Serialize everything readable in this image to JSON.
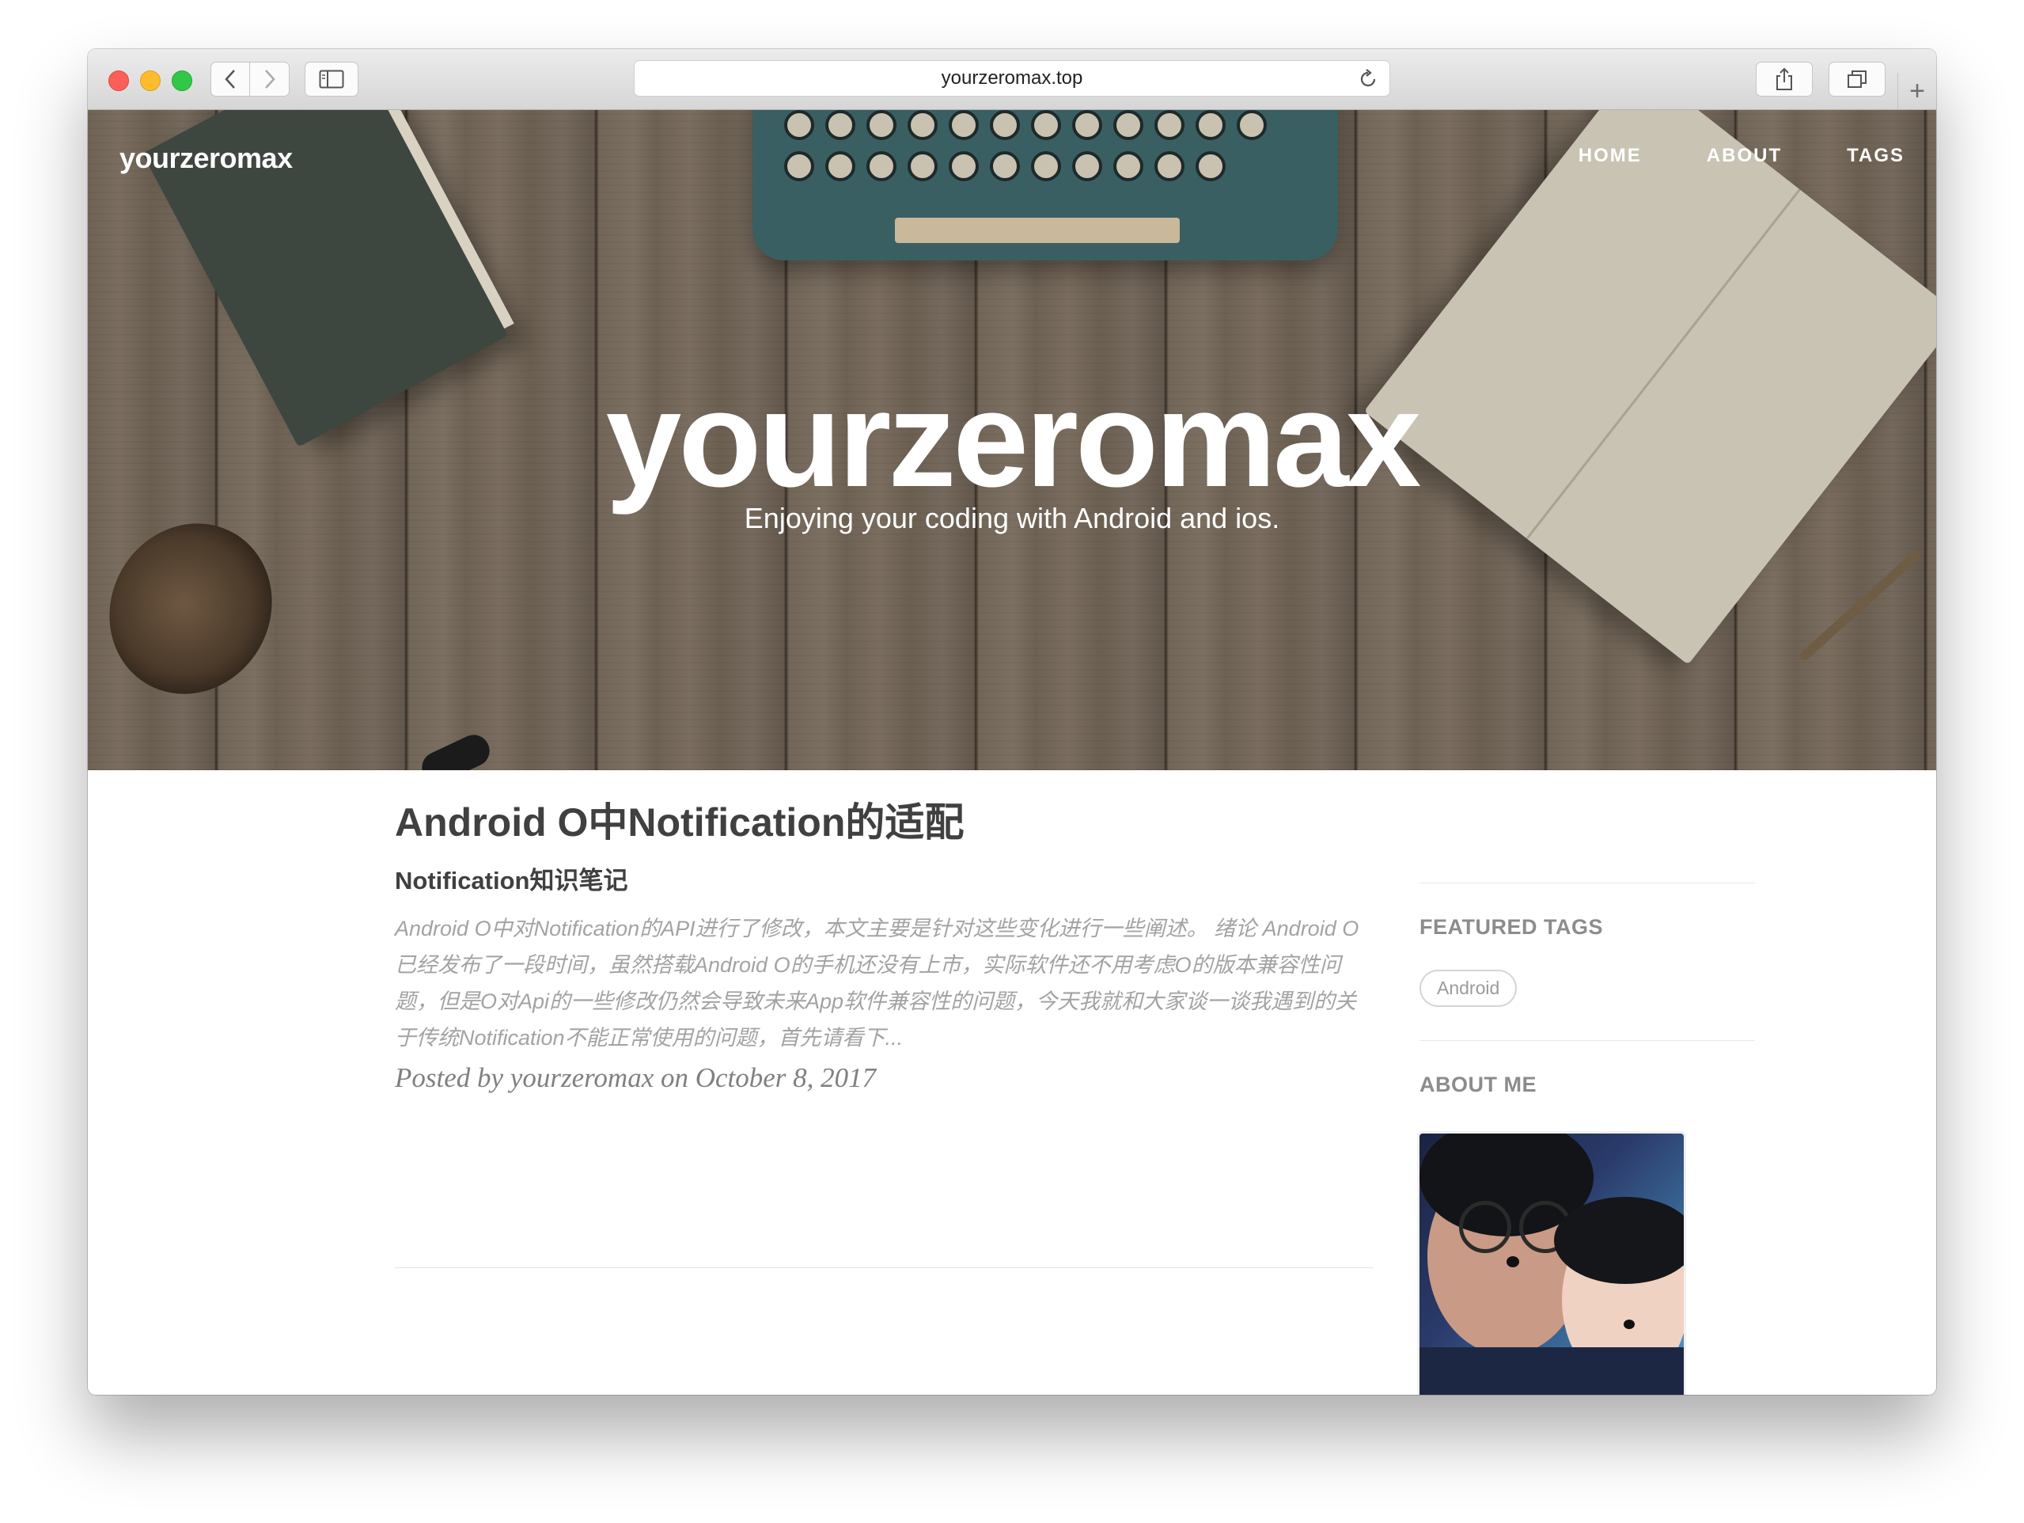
{
  "browser": {
    "url": "yourzeromax.top"
  },
  "site": {
    "brand": "yourzeromax",
    "nav": [
      "HOME",
      "ABOUT",
      "TAGS"
    ],
    "hero_title": "yourzeromax",
    "hero_subtitle": "Enjoying your coding with Android and ios."
  },
  "post": {
    "title": "Android O中Notification的适配",
    "subtitle": "Notification知识笔记",
    "excerpt": "Android O中对Notification的API进行了修改，本文主要是针对这些变化进行一些阐述。 绪论 Android O已经发布了一段时间，虽然搭载Android O的手机还没有上市，实际软件还不用考虑O的版本兼容性问题，但是O对Api的一些修改仍然会导致未来App软件兼容性的问题，今天我就和大家谈一谈我遇到的关于传统Notification不能正常使用的问题，首先请看下...",
    "meta": "Posted by yourzeromax on October 8, 2017"
  },
  "sidebar": {
    "featured_tags_title": "FEATURED TAGS",
    "tags": [
      "Android"
    ],
    "about_title": "ABOUT ME"
  },
  "icons": {
    "back": "chevron-left-icon",
    "forward": "chevron-right-icon",
    "sidebar": "sidebar-icon",
    "reload": "reload-icon",
    "share": "share-icon",
    "tabs": "tabs-icon",
    "new_tab": "plus-icon"
  }
}
